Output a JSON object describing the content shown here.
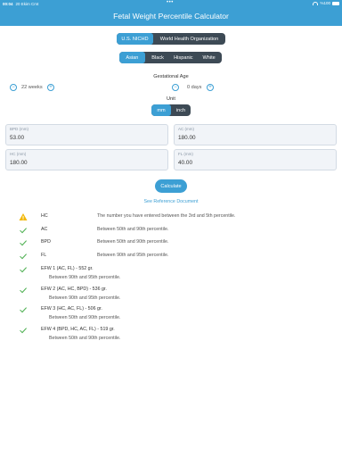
{
  "status_bar": {
    "time": "00:04",
    "date": "20 Ekim Cmt",
    "battery": "%100"
  },
  "app": {
    "title": "Fetal Weight Percentile Calculator"
  },
  "source_tabs": [
    {
      "label": "U.S. NICHD",
      "active": true
    },
    {
      "label": "World Health Organization",
      "active": false
    }
  ],
  "ethnicity_tabs": [
    {
      "label": "Asian",
      "active": true
    },
    {
      "label": "Black",
      "active": false
    },
    {
      "label": "Hispanic",
      "active": false
    },
    {
      "label": "White",
      "active": false
    }
  ],
  "gestational_age": {
    "label": "Gestational Age",
    "weeks": "22 weeks",
    "days": "0 days",
    "minus": "−",
    "plus": "+"
  },
  "unit": {
    "label": "Unit",
    "options": [
      {
        "label": "mm",
        "active": true
      },
      {
        "label": "inch",
        "active": false
      }
    ]
  },
  "fields": {
    "bpd": {
      "label": "BPD (mm)",
      "value": "53.00"
    },
    "ac": {
      "label": "AC (mm)",
      "value": "180.00"
    },
    "hc": {
      "label": "HC (mm)",
      "value": "180.00"
    },
    "fl": {
      "label": "FL (mm)",
      "value": "40.00"
    }
  },
  "calculate_label": "Calculate",
  "reference_link": "See Reference Document",
  "results": [
    {
      "icon": "warning-icon",
      "name": "HC",
      "desc": "The number you have entered between the 3rd and 5th percentile.",
      "desc2": ""
    },
    {
      "icon": "check-icon",
      "name": "AC",
      "desc": "Between 50th and 90th percentile.",
      "desc2": ""
    },
    {
      "icon": "check-icon",
      "name": "BPD",
      "desc": "Between 50th and 90th percentile.",
      "desc2": ""
    },
    {
      "icon": "check-icon",
      "name": "FL",
      "desc": "Between 90th and 95th percentile.",
      "desc2": ""
    },
    {
      "icon": "check-icon",
      "name": "EFW 1 (AC, FL) - 552 gr.",
      "desc": "",
      "desc2": "Between 90th and 95th percentile."
    },
    {
      "icon": "check-icon",
      "name": "EFW 2 (AC, HC, BPD) - 536 gr.",
      "desc": "",
      "desc2": "Between 90th and 95th percentile."
    },
    {
      "icon": "check-icon",
      "name": "EFW 3 (HC, AC, FL) - 506 gr.",
      "desc": "",
      "desc2": "Between 50th and 90th percentile."
    },
    {
      "icon": "check-icon",
      "name": "EFW 4 (BPD, HC, AC, FL) - 519 gr.",
      "desc": "",
      "desc2": "Between 50th and 90th percentile."
    }
  ],
  "colors": {
    "accent": "#3c9fd4",
    "segment_bg": "#3d4a55",
    "check": "#4caf50",
    "warning": "#f2b705"
  }
}
